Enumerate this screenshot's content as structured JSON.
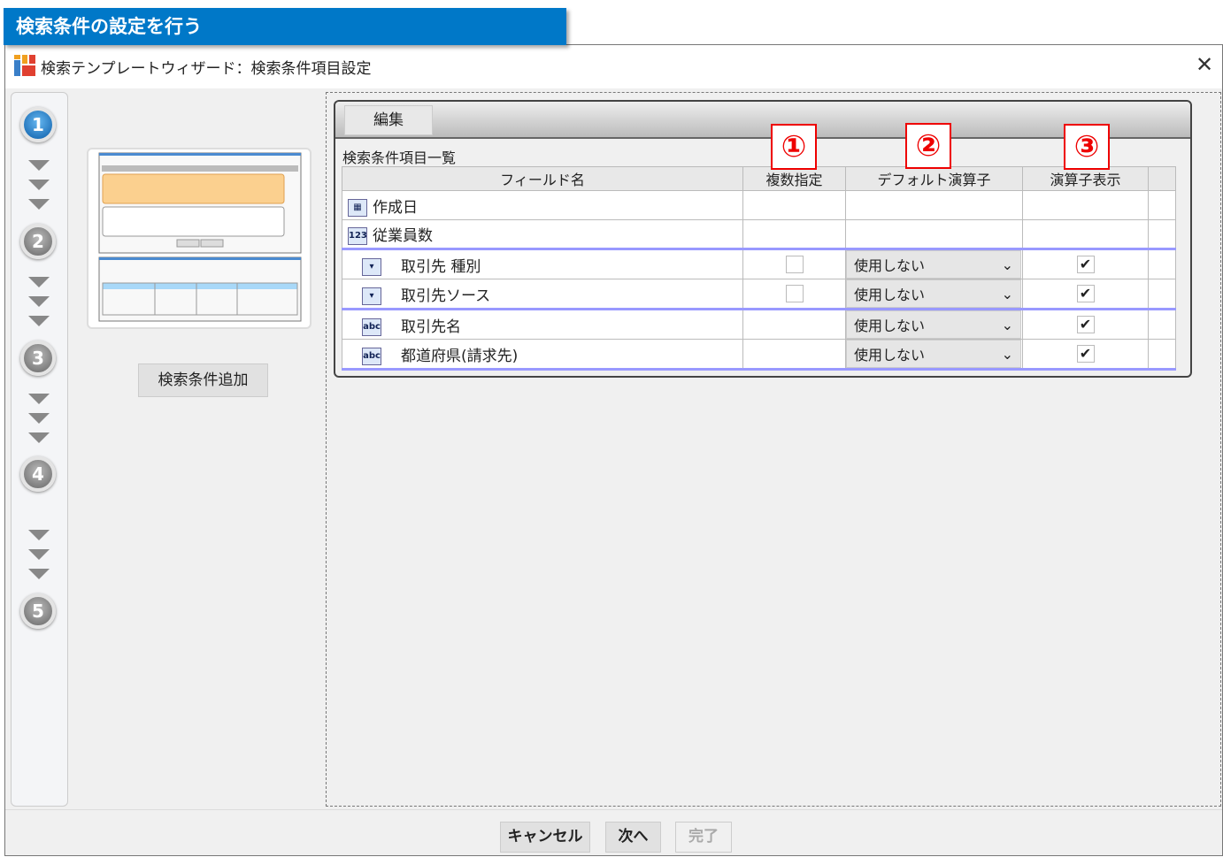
{
  "banner": "検索条件の設定を行う",
  "window": {
    "title": "検索テンプレートウィザード：検索条件項目設定"
  },
  "steps": [
    "1",
    "2",
    "3",
    "4",
    "5"
  ],
  "left": {
    "add_button": "検索条件追加"
  },
  "grid": {
    "toolbar_button": "編集",
    "list_label": "検索条件項目一覧",
    "columns": [
      "フィールド名",
      "複数指定",
      "デフォルト演算子",
      "演算子表示"
    ],
    "rows": [
      {
        "icon": "date-range-icon",
        "name": "作成日",
        "multi": null,
        "operator": null,
        "show": null
      },
      {
        "icon": "number-range-icon",
        "name": "従業員数",
        "multi": null,
        "operator": null,
        "show": null
      },
      {
        "icon": "picklist-icon",
        "name": "取引先 種別",
        "multi": false,
        "operator": "使用しない",
        "show": true
      },
      {
        "icon": "picklist-icon",
        "name": "取引先ソース",
        "multi": false,
        "operator": "使用しない",
        "show": true
      },
      {
        "icon": "text-icon",
        "name": "取引先名",
        "multi": null,
        "operator": "使用しない",
        "show": true
      },
      {
        "icon": "text-icon",
        "name": "都道府県(請求先)",
        "multi": null,
        "operator": "使用しない",
        "show": true
      }
    ]
  },
  "annotations": [
    "①",
    "②",
    "③"
  ],
  "footer": {
    "cancel": "キャンセル",
    "next": "次へ",
    "finish": "完了"
  },
  "colors": {
    "banner": "#0078c8",
    "annotation": "#ee0000",
    "group_separator": "#9999ff"
  }
}
